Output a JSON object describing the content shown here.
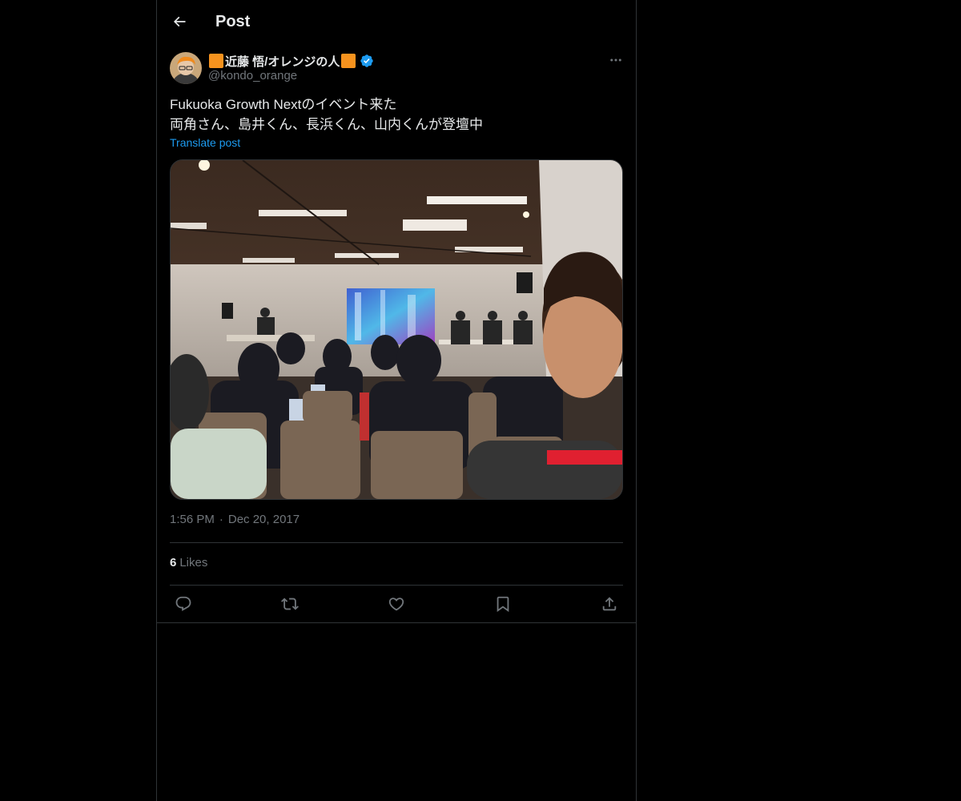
{
  "header": {
    "title": "Post",
    "back_icon": "arrow-left-icon"
  },
  "author": {
    "display_name": "近藤 悟/オレンジの人",
    "handle": "@kondo_orange",
    "verified": true,
    "name_emoji_color": "#f7931e",
    "verified_color": "#1d9bf0"
  },
  "post": {
    "lines": [
      "Fukuoka Growth Nextのイベント来た",
      "両角さん、島井くん、長浜くん、山内くんが登壇中"
    ],
    "translate_label": "Translate post"
  },
  "media": {
    "icon": "photo-event-panel-image"
  },
  "meta": {
    "time": "1:56 PM",
    "separator": "·",
    "date": "Dec 20, 2017"
  },
  "stats": {
    "likes_count": "6",
    "likes_label": "Likes"
  },
  "actions": {
    "reply_icon": "reply-icon",
    "repost_icon": "repost-icon",
    "like_icon": "heart-icon",
    "bookmark_icon": "bookmark-icon",
    "share_icon": "share-icon"
  },
  "colors": {
    "background": "#000000",
    "text": "#e7e9ea",
    "secondary": "#71767b",
    "accent": "#1d9bf0",
    "border": "#2f3336"
  }
}
